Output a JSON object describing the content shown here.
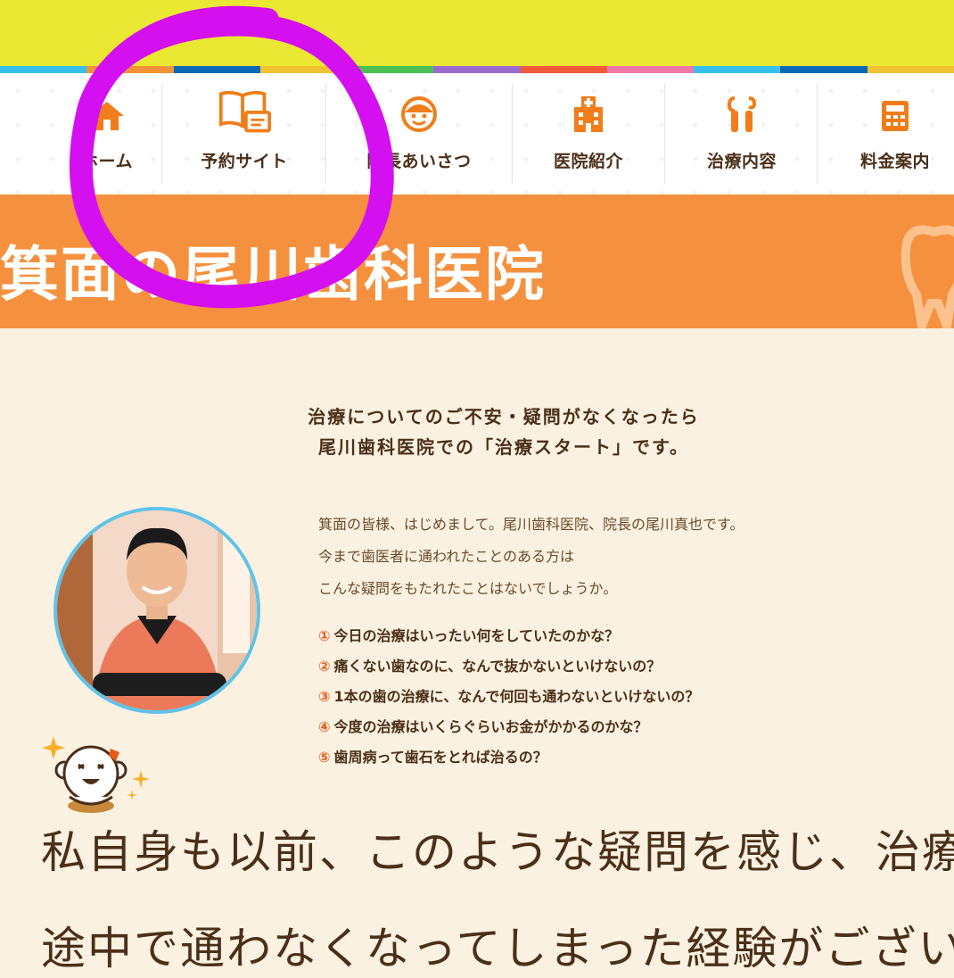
{
  "colors": {
    "topbar": "#ebe833",
    "orange": "#f5913e",
    "accent": "#e95a1a",
    "text": "#4b2f18",
    "background": "#faf1e1",
    "annotation_circle": "#d40ff0"
  },
  "stripes": [
    "#39c0ea",
    "#f29338",
    "#0a68b4",
    "#f1c232",
    "#4bc153",
    "#9b6bd0",
    "#f15b3c",
    "#f078a8",
    "#39c0ea",
    "#0a68b4",
    "#f1c232"
  ],
  "nav": {
    "items": [
      {
        "label": "ホーム",
        "icon": "home-icon"
      },
      {
        "label": "予約サイト",
        "icon": "booking-book-icon"
      },
      {
        "label": "院長あいさつ",
        "icon": "director-face-icon"
      },
      {
        "label": "医院紹介",
        "icon": "clinic-building-icon"
      },
      {
        "label": "治療内容",
        "icon": "dental-tools-icon"
      },
      {
        "label": "料金案内",
        "icon": "calculator-icon"
      }
    ]
  },
  "hero": {
    "title": "箕面の尾川歯科医院"
  },
  "lead": {
    "line1": "治療についてのご不安・疑問がなくなったら",
    "line2": "尾川歯科医院での「治療スタート」です。"
  },
  "intro": {
    "line1": "箕面の皆様、はじめまして。尾川歯科医院、院長の尾川真也です。",
    "line2": "今まで歯医者に通われたことのある方は",
    "line3": "こんな疑問をもたれたことはないでしょうか。"
  },
  "questions": [
    {
      "num": "①",
      "text": "今日の治療はいったい何をしていたのかな？"
    },
    {
      "num": "②",
      "text": "痛くない歯なのに、なんで抜かないといけないの？"
    },
    {
      "num": "③",
      "text": "1本の歯の治療に、なんで何回も通わないといけないの？"
    },
    {
      "num": "④",
      "text": "今度の治療はいくらぐらいお金がかかるのかな？"
    },
    {
      "num": "⑤",
      "text": "歯周病って歯石をとれば治るの？"
    }
  ],
  "body": {
    "line1": "私自身も以前、このような疑問を感じ、治療",
    "line2": "途中で通わなくなってしまった経験がござい"
  }
}
